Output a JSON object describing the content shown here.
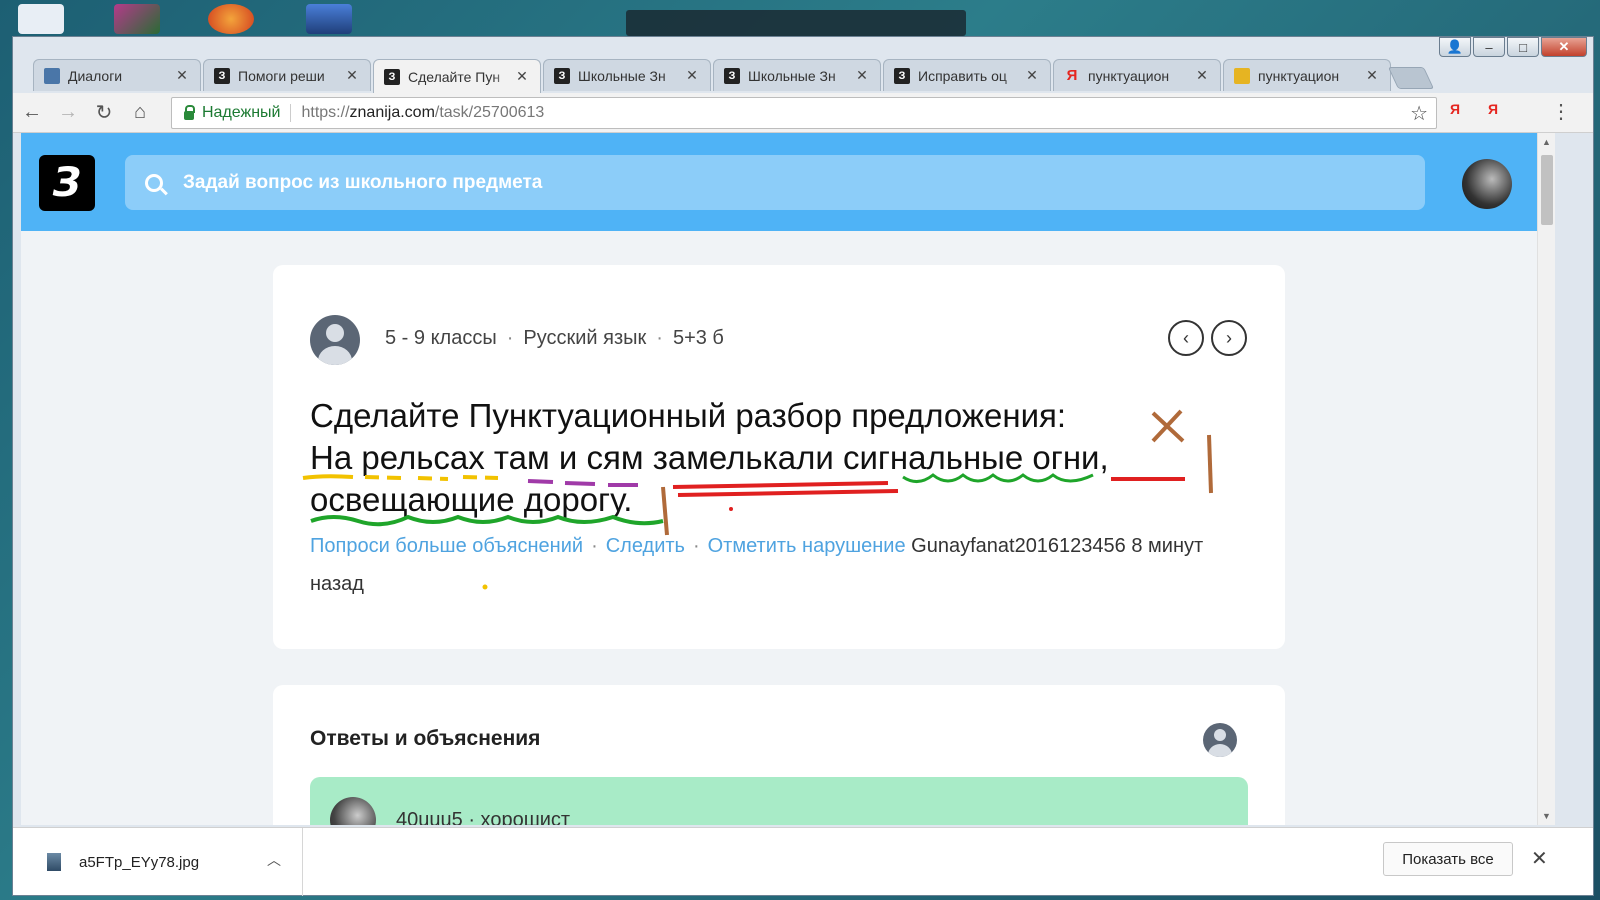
{
  "window": {
    "minimize": "‒",
    "maximize": "□",
    "close": "✕"
  },
  "tabs": [
    {
      "title": "Диалоги",
      "favicon": "dialog-icon",
      "fav_text": ""
    },
    {
      "title": "Помоги реши",
      "favicon": "znanija-icon",
      "fav_text": "З"
    },
    {
      "title": "Сделайте Пун",
      "favicon": "znanija-icon",
      "fav_text": "З",
      "active": true
    },
    {
      "title": "Школьные Зн",
      "favicon": "znanija-icon",
      "fav_text": "З"
    },
    {
      "title": "Школьные Зн",
      "favicon": "znanija-icon",
      "fav_text": "З"
    },
    {
      "title": "Исправить оц",
      "favicon": "znanija-icon",
      "fav_text": "З"
    },
    {
      "title": "пунктуацион",
      "favicon": "yandex-icon",
      "fav_text": "Я"
    },
    {
      "title": "пунктуацион",
      "favicon": "image-icon",
      "fav_text": ""
    }
  ],
  "toolbar": {
    "secure_label": "Надежный",
    "url_scheme": "https://",
    "url_domain": "znanija.com",
    "url_path": "/task/25700613",
    "ext1": "Я",
    "ext2": "Я"
  },
  "site": {
    "logo_text": "З",
    "search_placeholder": "Задай вопрос из школьного предмета"
  },
  "question": {
    "grade": "5 - 9 классы",
    "subject": "Русский язык",
    "points": "5+3 б",
    "text_line1": "Сделайте Пунктуационный разбор предложения:",
    "text_line2": "На рельсах там и сям замелькали сигнальные огни,",
    "text_line3": "освещающие дорогу.",
    "action_explain": "Попроси больше объяснений",
    "action_follow": "Следить",
    "action_report": "Отметить нарушение",
    "author": "Gunayfanat2016123456",
    "time": "8 минут назад",
    "separator": "·"
  },
  "answers": {
    "title": "Ответы и объяснения",
    "user": "40uuu5",
    "rank": "хорошист"
  },
  "download": {
    "filename": "a5FTp_EYy78.jpg",
    "show_all": "Показать все"
  },
  "colors": {
    "header_blue": "#4fb3f6",
    "link_blue": "#4fa3e0",
    "answer_green": "#a8ebc7",
    "scribble_yellow": "#f2c200",
    "scribble_purple": "#a03aa8",
    "scribble_red": "#e02020",
    "scribble_green": "#1fa52a",
    "scribble_brown": "#b06a3a"
  }
}
